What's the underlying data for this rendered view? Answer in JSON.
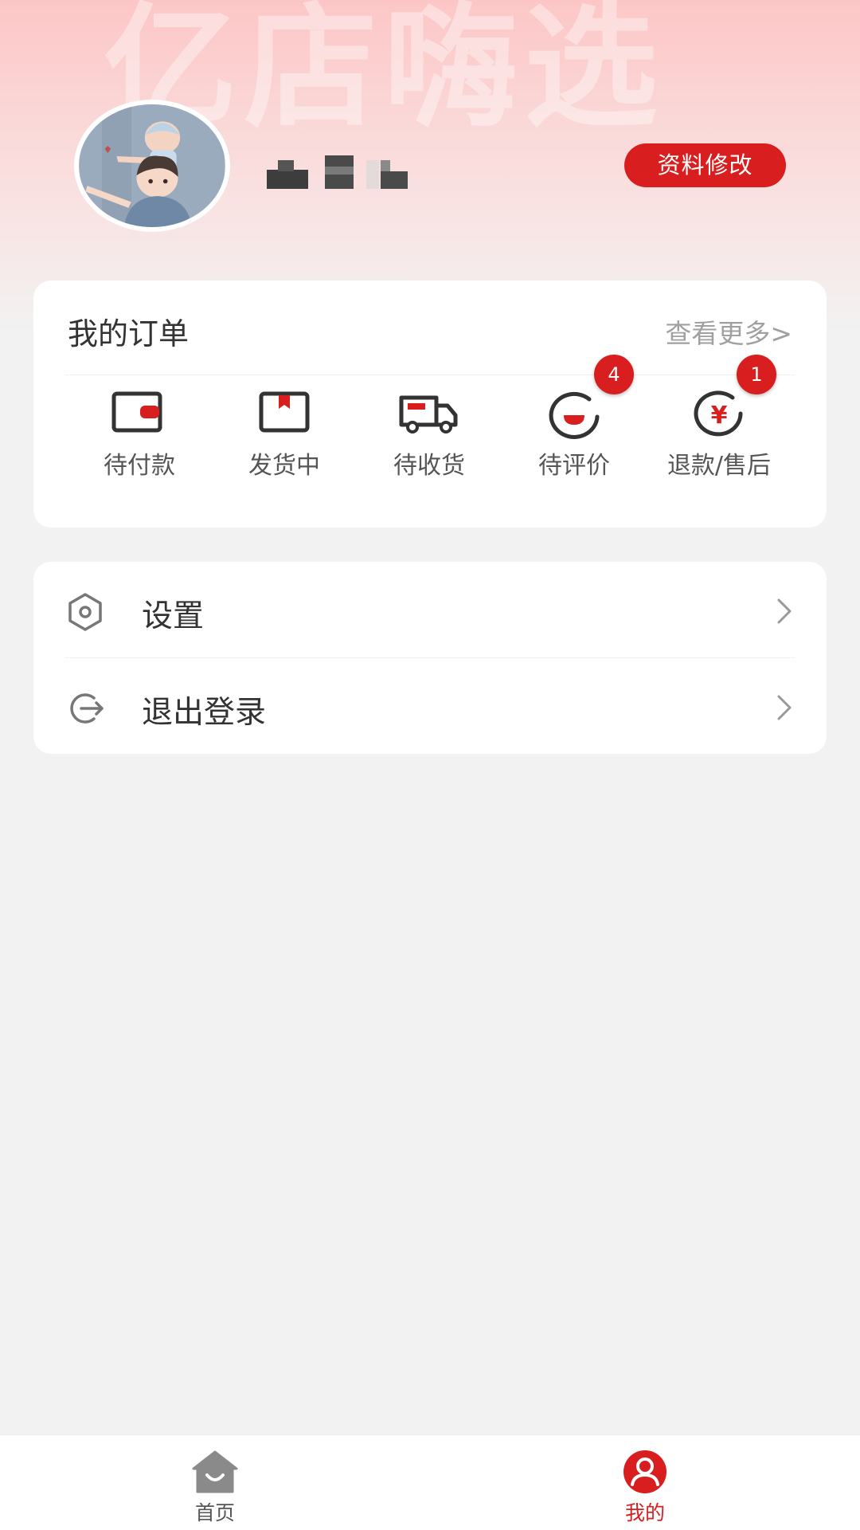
{
  "header": {
    "watermark": "亿店嗨选",
    "edit_profile_label": "资料修改"
  },
  "orders": {
    "title": "我的订单",
    "more_label": "查看更多>",
    "items": [
      {
        "label": "待付款",
        "icon": "wallet-icon"
      },
      {
        "label": "发货中",
        "icon": "package-icon"
      },
      {
        "label": "待收货",
        "icon": "truck-icon"
      },
      {
        "label": "待评价",
        "icon": "review-icon",
        "badge": "4"
      },
      {
        "label": "退款/售后",
        "icon": "refund-icon",
        "badge": "1"
      }
    ]
  },
  "menu": {
    "items": [
      {
        "label": "设置",
        "icon": "settings-icon"
      },
      {
        "label": "退出登录",
        "icon": "logout-icon"
      }
    ]
  },
  "tabbar": {
    "items": [
      {
        "label": "首页",
        "icon": "home-icon",
        "active": false
      },
      {
        "label": "我的",
        "icon": "profile-icon",
        "active": true
      }
    ]
  },
  "colors": {
    "accent": "#d81e1e",
    "background": "#f2f2f2",
    "header_pink": "#fcc6c6",
    "inactive": "#8a8a8a"
  }
}
